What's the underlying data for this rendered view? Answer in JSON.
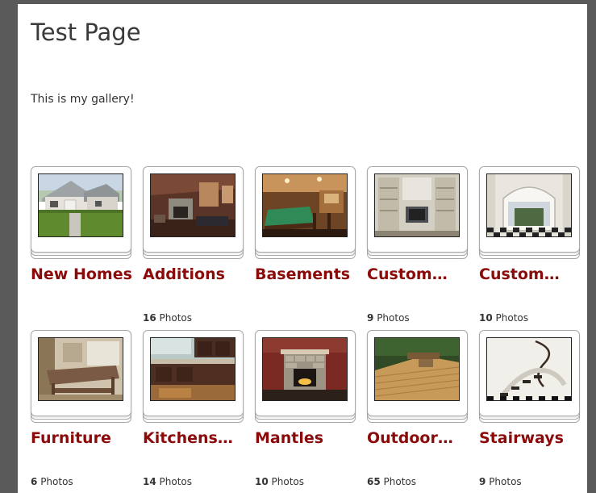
{
  "page": {
    "title": "Test Page",
    "intro": "This is my gallery!"
  },
  "colors": {
    "background": "#5a5a5a",
    "title_link": "#8b0a0a",
    "frame_border": "#a9a9a9"
  },
  "albums": [
    {
      "title": "New Homes",
      "count": "",
      "count_label": "",
      "thumbnail": "house-exterior"
    },
    {
      "title": "Additions",
      "count": "16",
      "count_label": "Photos",
      "thumbnail": "fireplace-room"
    },
    {
      "title": "Basements",
      "count": "",
      "count_label": "",
      "thumbnail": "basement-pool-table"
    },
    {
      "title": "Custom…",
      "count": "9",
      "count_label": "Photos",
      "thumbnail": "custom-shelving"
    },
    {
      "title": "Custom…",
      "count": "10",
      "count_label": "Photos",
      "thumbnail": "arched-window-room"
    },
    {
      "title": "Furniture",
      "count": "6",
      "count_label": "Photos",
      "thumbnail": "dining-table"
    },
    {
      "title": "Kitchens…",
      "count": "14",
      "count_label": "Photos",
      "thumbnail": "kitchen"
    },
    {
      "title": "Mantles",
      "count": "10",
      "count_label": "Photos",
      "thumbnail": "stone-fireplace"
    },
    {
      "title": "Outdoor…",
      "count": "65",
      "count_label": "Photos",
      "thumbnail": "wooden-deck"
    },
    {
      "title": "Stairways",
      "count": "9",
      "count_label": "Photos",
      "thumbnail": "spiral-staircase"
    }
  ]
}
